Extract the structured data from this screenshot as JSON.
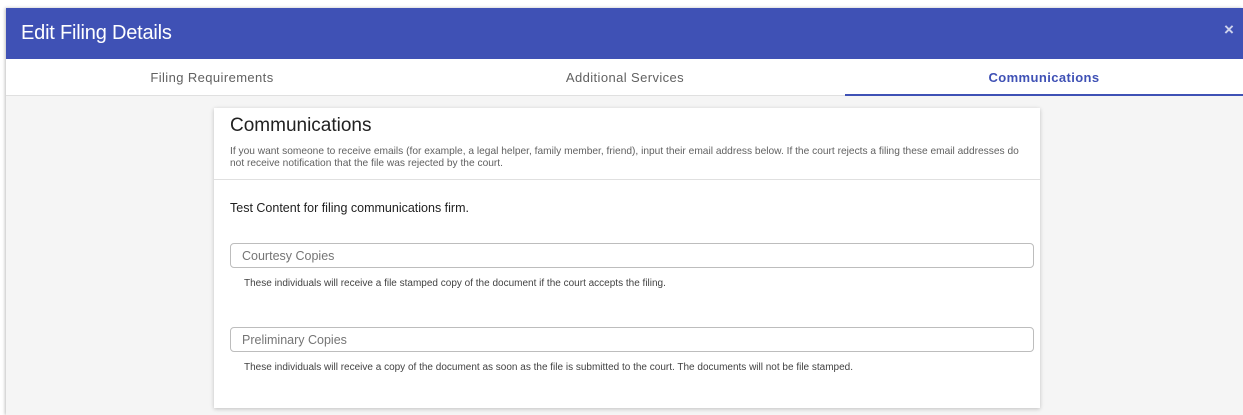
{
  "dialog": {
    "title": "Edit Filing Details",
    "close_symbol": "×"
  },
  "tabs": [
    {
      "label": "Filing Requirements"
    },
    {
      "label": "Additional Services"
    },
    {
      "label": "Communications",
      "active": true
    }
  ],
  "card": {
    "title": "Communications",
    "description": "If you want someone to receive emails (for example, a legal helper, family member, friend), input their email address below. If the court rejects a filing these email addresses do not receive notification that the file was rejected by the court.",
    "intro": "Test Content for filing communications firm."
  },
  "courtesy": {
    "placeholder": "Courtesy Copies",
    "hint": "These individuals will receive a file stamped copy of the document if the court accepts the filing."
  },
  "preliminary": {
    "placeholder": "Preliminary Copies",
    "hint": "These individuals will receive a copy of the document as soon as the file is submitted to the court. The documents will not be file stamped."
  },
  "colors": {
    "header": "#3f51b5",
    "active_tab": "#3f51b5"
  },
  "icons": {
    "close": "close-icon"
  }
}
